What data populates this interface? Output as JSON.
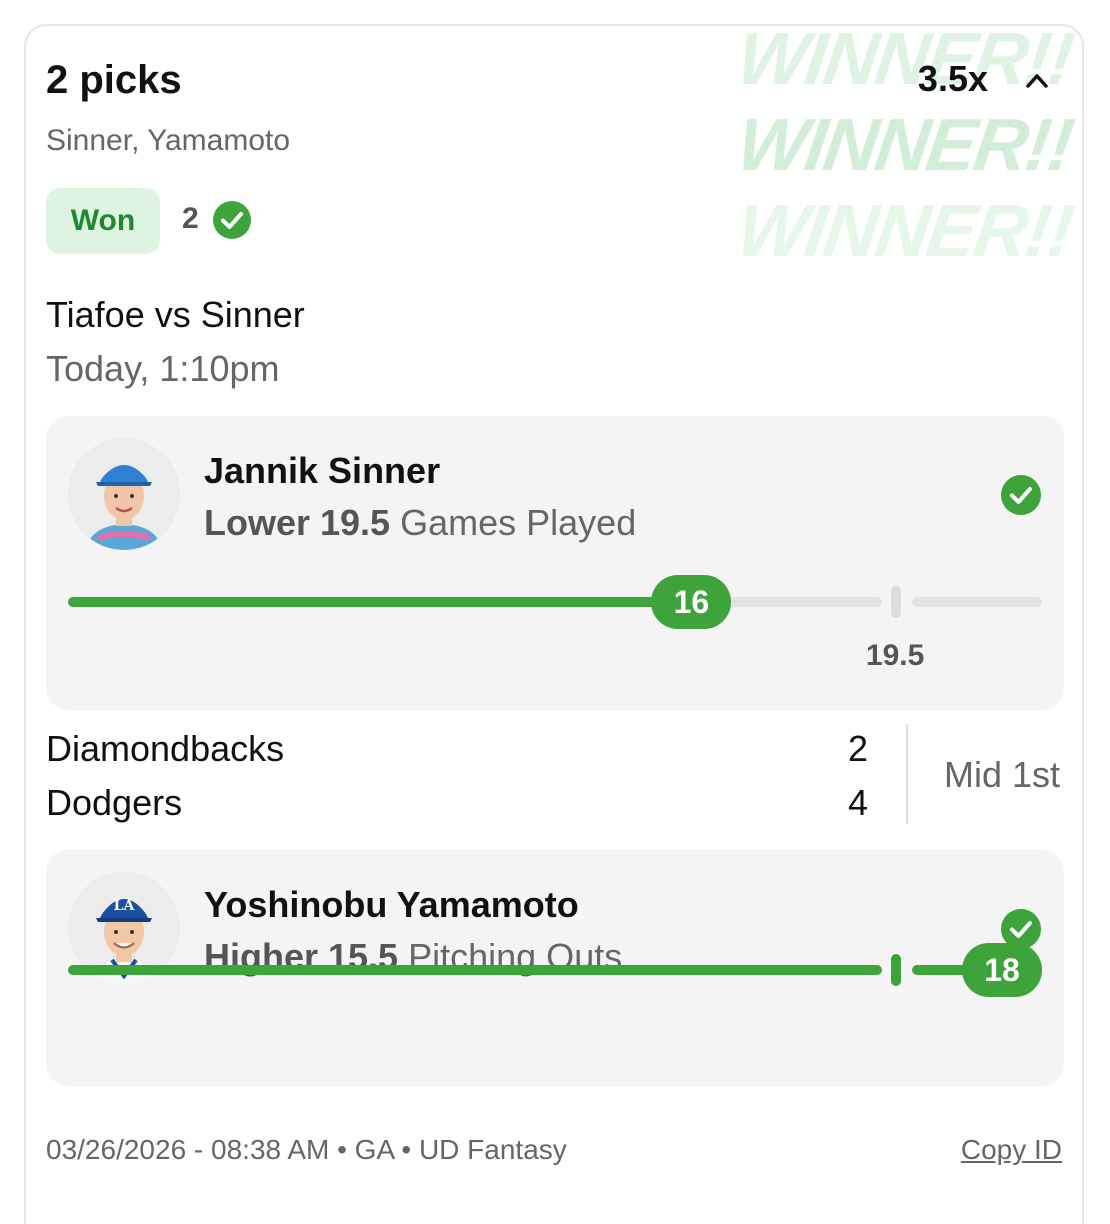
{
  "header": {
    "title": "2 picks",
    "players": "Sinner, Yamamoto",
    "multiplier": "3.5x",
    "winner_watermark": "WINNER!!"
  },
  "status": {
    "label": "Won",
    "correct_count": "2"
  },
  "match1": {
    "title": "Tiafoe vs Sinner",
    "time": "Today, 1:10pm"
  },
  "pick1": {
    "player": "Jannik Sinner",
    "direction_line": "Lower 19.5",
    "stat": "Games Played",
    "current": "16",
    "line": "19.5",
    "progress_fraction": 0.64,
    "line_fraction": 0.85
  },
  "match2": {
    "team1": "Diamondbacks",
    "team1_score": "2",
    "team2": "Dodgers",
    "team2_score": "4",
    "inning": "Mid 1st"
  },
  "pick2": {
    "player": "Yoshinobu Yamamoto",
    "direction_line": "Higher 15.5",
    "stat": "Pitching Outs",
    "current": "18",
    "line_fraction": 0.85
  },
  "footer": {
    "meta": "03/26/2026 - 08:38 AM • GA • UD Fantasy",
    "copy_label": "Copy ID"
  },
  "colors": {
    "green": "#3ea33a",
    "won_bg": "#dff3e3",
    "won_text": "#1e8a2e",
    "card_bg": "#f4f4f4"
  },
  "icons": [
    "chevron-up-icon",
    "check-circle-icon",
    "player-avatar"
  ]
}
